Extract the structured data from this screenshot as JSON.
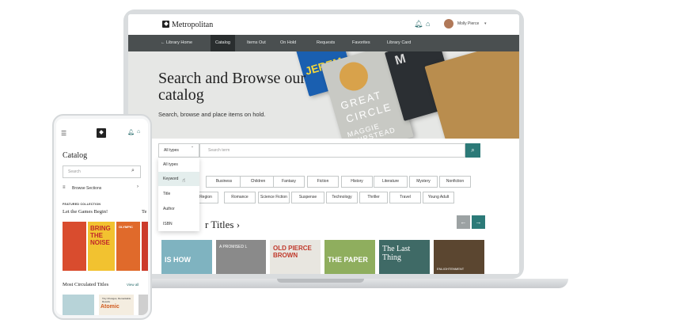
{
  "brand": {
    "name": "Metropolitan"
  },
  "header": {
    "user_name": "Molly Pierce"
  },
  "nav": {
    "back_label": "Library Home",
    "items": [
      "Catalog",
      "Items Out",
      "On Hold",
      "Requests",
      "Favorites",
      "Library Card"
    ],
    "active": "Catalog"
  },
  "hero": {
    "title": "Search and Browse our catalog",
    "subtitle": "Search, browse and place items on hold.",
    "book_texts": [
      "JEREM",
      "GREAT",
      "CIRCLE",
      "MAGGIE SHIPSTEAD",
      "M"
    ]
  },
  "search": {
    "type_value": "All types",
    "placeholder": "Search term",
    "type_options": [
      "All types",
      "Keyword",
      "Title",
      "Author",
      "ISBN"
    ],
    "hovered_option": "Keyword"
  },
  "genres": {
    "row1": [
      "Business",
      "Children",
      "Fantasy",
      "Fiction",
      "History",
      "Literature",
      "Mystery",
      "Nonfiction"
    ],
    "row2": [
      "Region",
      "Romance",
      "Science Fiction",
      "Suspense",
      "Technology",
      "Thriller",
      "Travel",
      "Young Adult"
    ]
  },
  "popular": {
    "title_visible": "r Titles",
    "covers": [
      {
        "text": "IS HOW",
        "color": "#7fb3c0"
      },
      {
        "text": "A PROMISED L",
        "color": "#8a8a8a"
      },
      {
        "text": "OLD PIERCE BROWN",
        "color": "#e8e6e0"
      },
      {
        "text": "THE PAPER",
        "color": "#8fae5e"
      },
      {
        "text": "The Last Thing",
        "color": "#3f6a66"
      },
      {
        "text": "ENLIGHTENMENT",
        "color": "#5b4630"
      }
    ]
  },
  "phone": {
    "title": "Catalog",
    "search_placeholder": "Search",
    "browse_label": "Browse Sections",
    "featured_label": "FEATURED COLLECTION",
    "collection_title": "Let the Games Begin!",
    "collection_title_next": "Te",
    "books": [
      {
        "text": "",
        "color": "#d94c2e"
      },
      {
        "text": "BRING THE NOISE",
        "color": "#f2c230"
      },
      {
        "text": "OLYMPIC",
        "color": "#e06a2b"
      }
    ],
    "most_label": "Most Circulated Titles",
    "view_all": "View all",
    "mini_books": [
      {
        "text": "",
        "color": "#b7d3d8"
      },
      {
        "text": "Atomic",
        "color": "#f4ede0",
        "small": "Tiny Changes, Remarkable Results"
      },
      {
        "text": "",
        "color": "#cfcfcf"
      }
    ]
  },
  "colors": {
    "accent": "#2c7a78",
    "nav": "#4a4f50"
  }
}
